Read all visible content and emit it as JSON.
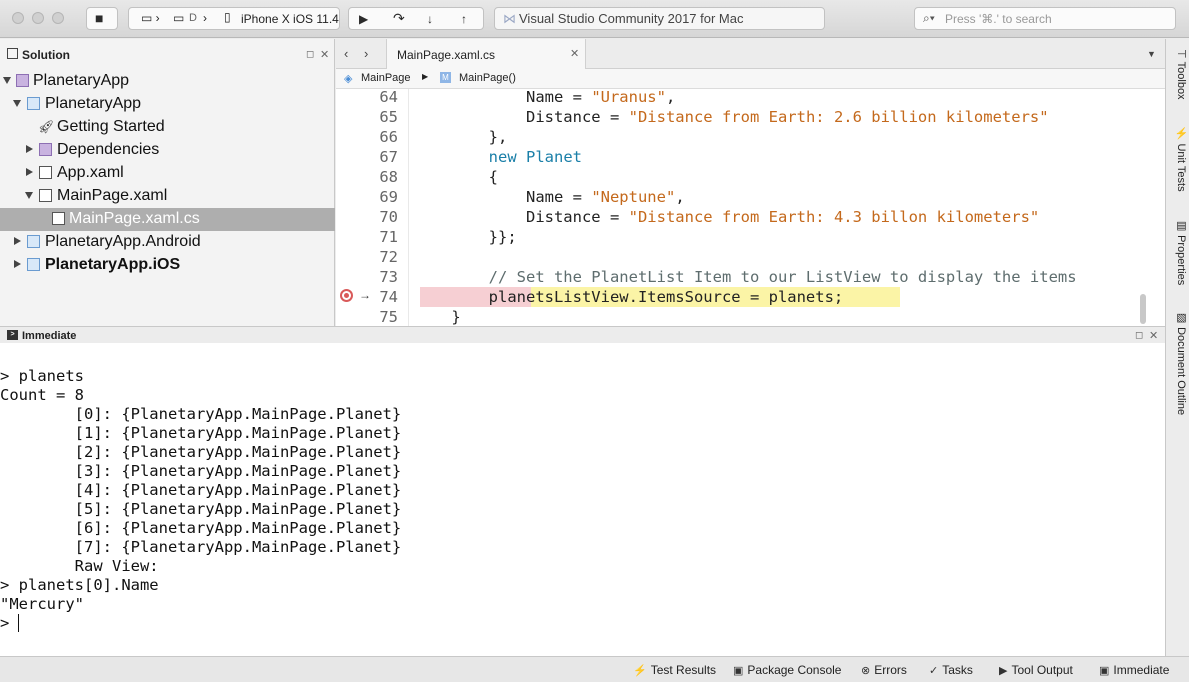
{
  "toolbar": {
    "run_glyph": "▶",
    "step_over_glyph": "↷",
    "step_into_glyph": "↓",
    "step_out_glyph": "↑",
    "stop_glyph": "■",
    "config_project": "D",
    "config_device": "iPhone X iOS 11.4",
    "status_text": "Visual Studio Community 2017 for Mac",
    "search_placeholder": "Press '⌘.' to search"
  },
  "solution": {
    "title": "Solution",
    "items": [
      {
        "label": "PlanetaryApp",
        "icon": "solution-icon"
      },
      {
        "label": "PlanetaryApp",
        "icon": "project-icon"
      },
      {
        "label": "Getting Started",
        "icon": "rocket-icon"
      },
      {
        "label": "Dependencies",
        "icon": "folder-icon"
      },
      {
        "label": "App.xaml",
        "icon": "xaml-file-icon"
      },
      {
        "label": "MainPage.xaml",
        "icon": "xaml-file-icon"
      },
      {
        "label": "MainPage.xaml.cs",
        "icon": "cs-file-icon"
      },
      {
        "label": "PlanetaryApp.Android",
        "icon": "project-icon"
      },
      {
        "label": "PlanetaryApp.iOS",
        "icon": "project-icon"
      }
    ]
  },
  "editor": {
    "active_tab": "MainPage.xaml.cs",
    "path_class": "MainPage",
    "path_member": "MainPage()",
    "lines": [
      {
        "n": "64",
        "parts": [
          [
            "",
            "            Name = "
          ],
          [
            "str",
            "\"Uranus\""
          ],
          [
            "",
            ","
          ]
        ]
      },
      {
        "n": "65",
        "parts": [
          [
            "",
            "            Distance = "
          ],
          [
            "str",
            "\"Distance from Earth: 2.6 billion kilometers\""
          ]
        ]
      },
      {
        "n": "66",
        "parts": [
          [
            "",
            "        },"
          ]
        ]
      },
      {
        "n": "67",
        "parts": [
          [
            "",
            "        "
          ],
          [
            "kw",
            "new"
          ],
          [
            "",
            " "
          ],
          [
            "typ",
            "Planet"
          ]
        ]
      },
      {
        "n": "68",
        "parts": [
          [
            "",
            "        {"
          ]
        ]
      },
      {
        "n": "69",
        "parts": [
          [
            "",
            "            Name = "
          ],
          [
            "str",
            "\"Neptune\""
          ],
          [
            "",
            ","
          ]
        ]
      },
      {
        "n": "70",
        "parts": [
          [
            "",
            "            Distance = "
          ],
          [
            "str",
            "\"Distance from Earth: 4.3 billon kilometers\""
          ]
        ]
      },
      {
        "n": "71",
        "parts": [
          [
            "",
            "        }};"
          ]
        ]
      },
      {
        "n": "72",
        "parts": [
          [
            "",
            ""
          ]
        ]
      },
      {
        "n": "73",
        "parts": [
          [
            "",
            "        "
          ],
          [
            "cm",
            "// Set the PlanetList Item to our ListView to display the items"
          ]
        ]
      },
      {
        "n": "74",
        "parts": [
          [
            "",
            "        planetsListView.ItemsSource = planets;"
          ]
        ]
      },
      {
        "n": "75",
        "parts": [
          [
            "",
            "    }"
          ]
        ]
      }
    ]
  },
  "immediate": {
    "title": "Immediate",
    "lines": [
      "> planets",
      "Count = 8",
      "        [0]: {PlanetaryApp.MainPage.Planet}",
      "        [1]: {PlanetaryApp.MainPage.Planet}",
      "        [2]: {PlanetaryApp.MainPage.Planet}",
      "        [3]: {PlanetaryApp.MainPage.Planet}",
      "        [4]: {PlanetaryApp.MainPage.Planet}",
      "        [5]: {PlanetaryApp.MainPage.Planet}",
      "        [6]: {PlanetaryApp.MainPage.Planet}",
      "        [7]: {PlanetaryApp.MainPage.Planet}",
      "        Raw View:",
      "> planets[0].Name",
      "\"Mercury\"",
      "> "
    ]
  },
  "right_rail": {
    "items": [
      "Toolbox",
      "Unit Tests",
      "Properties",
      "Document Outline"
    ]
  },
  "statusbar": {
    "items": [
      {
        "label": "Test Results",
        "icon": "⚡"
      },
      {
        "label": "Package Console",
        "icon": "▣"
      },
      {
        "label": "Errors",
        "icon": "⊗"
      },
      {
        "label": "Tasks",
        "icon": "✓"
      },
      {
        "label": "Tool Output",
        "icon": "▶"
      },
      {
        "label": "Immediate",
        "icon": "▣"
      }
    ]
  }
}
